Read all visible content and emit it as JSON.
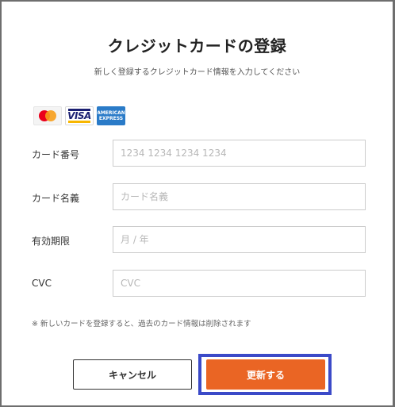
{
  "modal": {
    "title": "クレジットカードの登録",
    "subtitle": "新しく登録するクレジットカード情報を入力してください"
  },
  "brands": {
    "mastercard": {
      "icon": "mastercard-logo",
      "colors": [
        "#eb001b",
        "#f79e1b"
      ]
    },
    "visa": {
      "text": "VISA",
      "icon": "visa-logo"
    },
    "amex": {
      "line1": "AMERICAN",
      "line2": "EXPRESS",
      "icon": "amex-logo"
    }
  },
  "fields": {
    "card_number": {
      "label": "カード番号",
      "value": "",
      "placeholder": "1234 1234 1234 1234"
    },
    "card_name": {
      "label": "カード名義",
      "value": "",
      "placeholder": "カード名義"
    },
    "expiry": {
      "label": "有効期限",
      "value": "",
      "placeholder": "月 / 年"
    },
    "cvc": {
      "label": "CVC",
      "value": "",
      "placeholder": "CVC"
    }
  },
  "note": "※ 新しいカードを登録すると、過去のカード情報は削除されます",
  "buttons": {
    "cancel": "キャンセル",
    "update": "更新する"
  },
  "colors": {
    "accent": "#ea6524",
    "focus_ring": "#3b4ac8"
  }
}
